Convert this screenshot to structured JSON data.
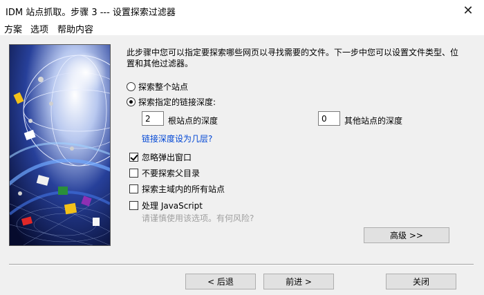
{
  "window": {
    "title": "IDM 站点抓取。步骤 3 --- 设置探索过滤器",
    "close_glyph": "✕"
  },
  "menu": [
    "方案",
    "选项",
    "帮助内容"
  ],
  "description": "此步骤中您可以指定要探索哪些网页以寻找需要的文件。下一步中您可以设置文件类型、位置和其他过滤器。",
  "radios": {
    "whole_site": {
      "label": "探索整个站点",
      "selected": false
    },
    "link_depth": {
      "label": "探索指定的链接深度:",
      "selected": true
    }
  },
  "depth": {
    "root_value": "2",
    "root_label": "根站点的深度",
    "other_value": "0",
    "other_label": "其他站点的深度",
    "link": "链接深度设为几层?"
  },
  "checkboxes": {
    "ignore_popups": {
      "label": "忽略弹出窗口",
      "checked": true
    },
    "no_parent": {
      "label": "不要探索父目录",
      "checked": false
    },
    "all_domain_sites": {
      "label": "探索主域内的所有站点",
      "checked": false
    },
    "javascript": {
      "label": "处理 JavaScript",
      "checked": false
    }
  },
  "hint": "请谨慎使用该选项。有何风险?",
  "buttons": {
    "advanced": "高级 >>",
    "back": "< 后退",
    "next": "前进 >",
    "close": "关闭"
  },
  "colors": {
    "link": "#0046d5",
    "hint": "#a0a0a0",
    "background": "#f0f0f0"
  }
}
